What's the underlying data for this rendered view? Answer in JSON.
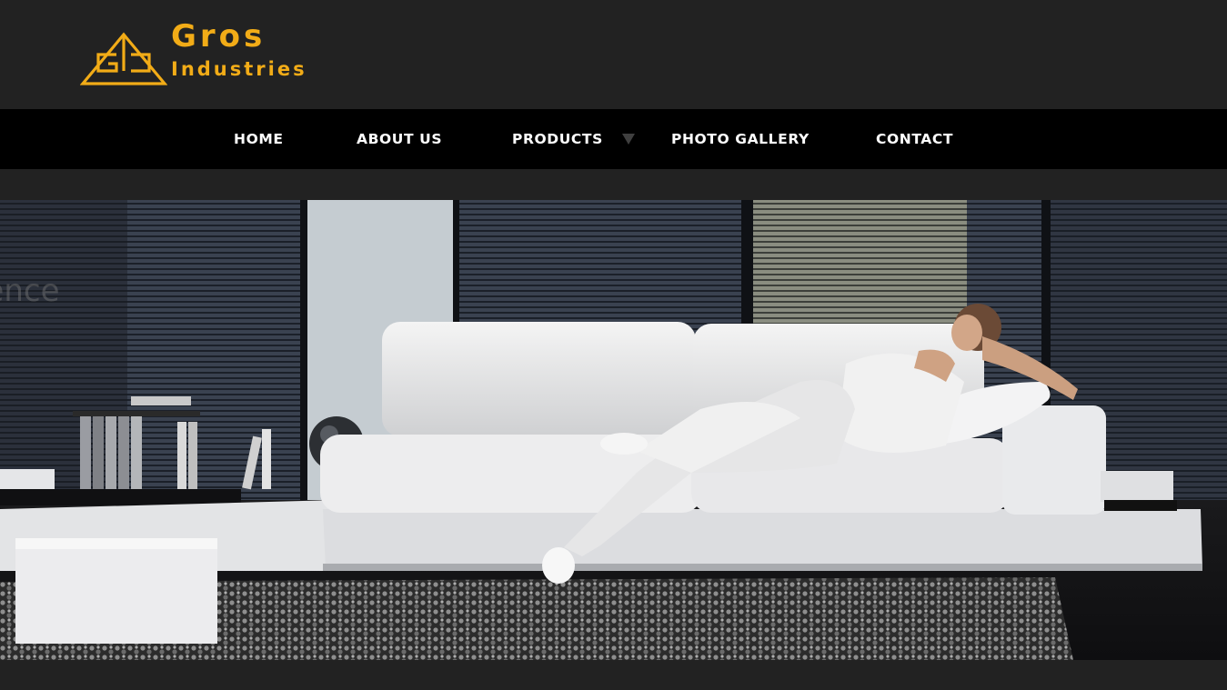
{
  "brand": {
    "name_line1": "Gros",
    "name_line2": "Industries",
    "accent_color": "#f2ac17",
    "logo_icon": "triangle-gi-monogram-icon"
  },
  "nav": {
    "items": [
      {
        "label": "HOME"
      },
      {
        "label": "ABOUT US"
      },
      {
        "label": "PRODUCTS",
        "has_dropdown": true
      },
      {
        "label": "PHOTO GALLERY"
      },
      {
        "label": "CONTACT"
      }
    ],
    "dropdown_icon": "caret-down-icon"
  },
  "hero": {
    "caption_fragment": "rience",
    "image": "living-room-white-sofa-photo"
  },
  "colors": {
    "header_bg": "#222222",
    "nav_bg": "#000000",
    "nav_text": "#ffffff"
  }
}
